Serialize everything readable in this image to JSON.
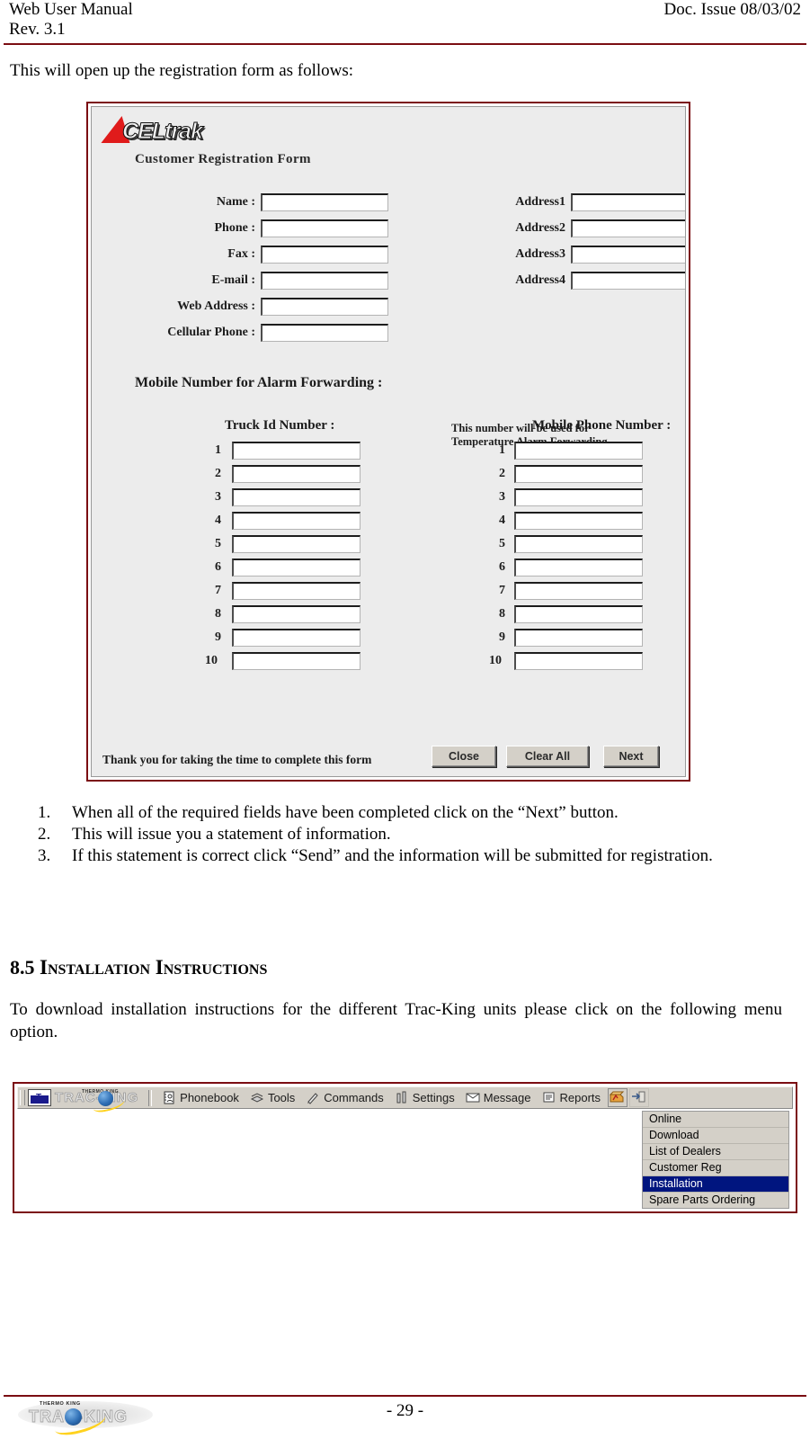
{
  "header": {
    "left_line1": "Web User Manual",
    "left_line2": "Rev. 3.1",
    "right": "Doc. Issue 08/03/02",
    "rule_color": "#7b0d12"
  },
  "intro": {
    "text": "This will open up the registration form as follows:"
  },
  "registration_form": {
    "logo_word": "CELtrak",
    "title": "Customer Registration Form",
    "left_fields": [
      {
        "label": "Name :",
        "value": ""
      },
      {
        "label": "Phone :",
        "value": ""
      },
      {
        "label": "Fax :",
        "value": ""
      },
      {
        "label": "E-mail :",
        "value": ""
      },
      {
        "label": "Web Address :",
        "value": ""
      },
      {
        "label": "Cellular Phone :",
        "value": ""
      }
    ],
    "right_fields": [
      {
        "label": "Address1",
        "value": ""
      },
      {
        "label": "Address2",
        "value": ""
      },
      {
        "label": "Address3",
        "value": ""
      },
      {
        "label": "Address4",
        "value": ""
      }
    ],
    "note": "This number will be used for Temperature Alarm Forwarding",
    "mobile_heading": "Mobile Number for Alarm Forwarding :",
    "truck_column_heading": "Truck Id Number :",
    "mobile_column_heading": "Mobile Phone Number :",
    "row_numbers": [
      "1",
      "2",
      "3",
      "4",
      "5",
      "6",
      "7",
      "8",
      "9",
      "10"
    ],
    "thanks": "Thank you for taking the time to complete this form",
    "buttons": [
      {
        "label": "Close"
      },
      {
        "label": "Clear All"
      },
      {
        "label": "Next"
      }
    ]
  },
  "steps": [
    {
      "num": "1.",
      "text": "When all of the required fields have been completed click on the “Next” button."
    },
    {
      "num": "2.",
      "text": "This will issue you a statement of information."
    },
    {
      "num": "3.",
      "text": "If this statement is correct click “Send” and the information will be submitted for registration."
    }
  ],
  "section": {
    "number": "8.5",
    "title": "Installation Instructions",
    "paragraph": "To download installation instructions for the different Trac-King units please click on the following menu option."
  },
  "menu_screenshot": {
    "logo_word": "TRAC-KING",
    "logo_tiny": "THERMO KING",
    "toolbar_items": [
      {
        "label": "Phonebook",
        "icon": "phonebook-icon"
      },
      {
        "label": "Tools",
        "icon": "tools-icon"
      },
      {
        "label": "Commands",
        "icon": "commands-icon"
      },
      {
        "label": "Settings",
        "icon": "settings-icon"
      },
      {
        "label": "Message",
        "icon": "message-icon"
      },
      {
        "label": "Reports",
        "icon": "reports-icon"
      }
    ],
    "toolbar_buttons": [
      {
        "name": "help-icon"
      },
      {
        "name": "exit-icon"
      }
    ],
    "dropdown": {
      "items": [
        {
          "label": "Online",
          "selected": false
        },
        {
          "label": "Download",
          "selected": false
        },
        {
          "label": "List of Dealers",
          "selected": false
        },
        {
          "label": "Customer Reg",
          "selected": false
        },
        {
          "label": "Installation",
          "selected": true
        },
        {
          "label": "Spare Parts Ordering",
          "selected": false
        }
      ],
      "highlight_color": "#00157f"
    }
  },
  "footer": {
    "logo_word": "TRAC-KING",
    "logo_tiny": "THERMO KING",
    "page_number": "- 29 -"
  }
}
